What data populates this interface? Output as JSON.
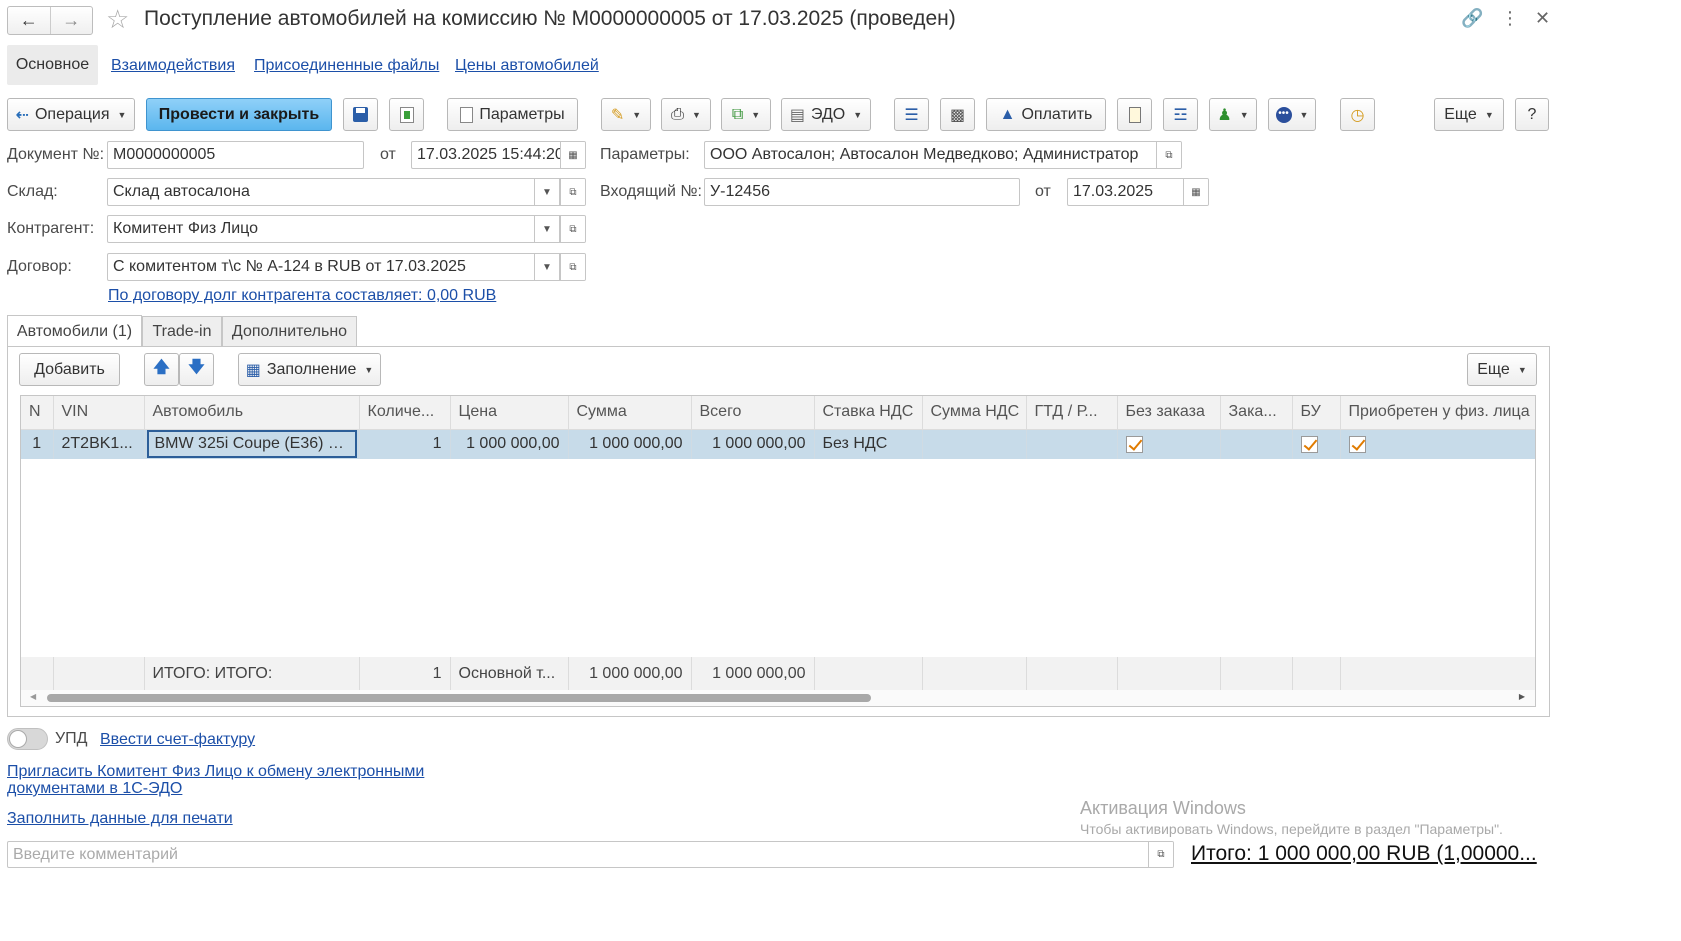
{
  "window": {
    "title": "Поступление автомобилей на комиссию № М0000000005 от 17.03.2025 (проведен)"
  },
  "nav_tabs": [
    "Основное",
    "Взаимодействия",
    "Присоединенные файлы",
    "Цены автомобилей"
  ],
  "toolbar": {
    "operation": "Операция",
    "post_close": "Провести и закрыть",
    "params": "Параметры",
    "edo": "ЭДО",
    "pay": "Оплатить",
    "more": "Еще",
    "help": "?"
  },
  "form": {
    "doc_no_label": "Документ №:",
    "doc_no": "М0000000005",
    "from_label": "от",
    "doc_date": "17.03.2025 15:44:20",
    "params_label": "Параметры:",
    "params_value": "ООО Автосалон; Автосалон Медведково; Администратор",
    "warehouse_label": "Склад:",
    "warehouse": "Склад автосалона",
    "incoming_label": "Входящий №:",
    "incoming_no": "У-12456",
    "incoming_from_label": "от",
    "incoming_date": "17.03.2025",
    "counterparty_label": "Контрагент:",
    "counterparty": "Комитент Физ Лицо",
    "contract_label": "Договор:",
    "contract": "С комитентом т\\с № А-124 в RUB от 17.03.2025",
    "debt_link": "По договору долг контрагента составляет: 0,00 RUB"
  },
  "section_tabs": [
    "Автомобили (1)",
    "Trade-in",
    "Дополнительно"
  ],
  "table_toolbar": {
    "add": "Добавить",
    "fill": "Заполнение",
    "more": "Еще"
  },
  "table": {
    "columns": [
      "N",
      "VIN",
      "Автомобиль",
      "Количе...",
      "Цена",
      "Сумма",
      "Всего",
      "Ставка НДС",
      "Сумма НДС",
      "ГТД / Р...",
      "Без заказа",
      "Зака...",
      "БУ",
      "Приобретен у физ. лица"
    ],
    "rows": [
      {
        "n": "1",
        "vin": "2T2BK1...",
        "car": "BMW 325i Coupe (E36) V...",
        "qty": "1",
        "price": "1 000 000,00",
        "sum": "1 000 000,00",
        "total": "1 000 000,00",
        "vat_rate": "Без НДС",
        "vat_sum": "",
        "gtd": "",
        "no_order": true,
        "order": "",
        "used": true,
        "from_individual": true
      }
    ],
    "footer": {
      "label": "ИТОГО: ИТОГО:",
      "qty": "1",
      "price": "Основной т...",
      "sum": "1 000 000,00",
      "total": "1 000 000,00"
    }
  },
  "bottom": {
    "upd_label": "УПД",
    "invoice_link": "Ввести счет-фактуру",
    "invite_link": "Пригласить Комитент Физ Лицо к обмену электронными документами в 1С-ЭДО",
    "print_link": "Заполнить данные для печати",
    "comment_placeholder": "Введите комментарий",
    "total": "Итого: 1 000 000,00 RUB (1,00000..."
  },
  "watermark": {
    "title": "Активация Windows",
    "subtitle": "Чтобы активировать Windows, перейдите в раздел \"Параметры\"."
  },
  "colors": {
    "primary_button": "#5bb6ee",
    "link": "#1c4fa8",
    "selected_row": "#c7dbe9",
    "checkbox_mark": "#e07b00"
  }
}
